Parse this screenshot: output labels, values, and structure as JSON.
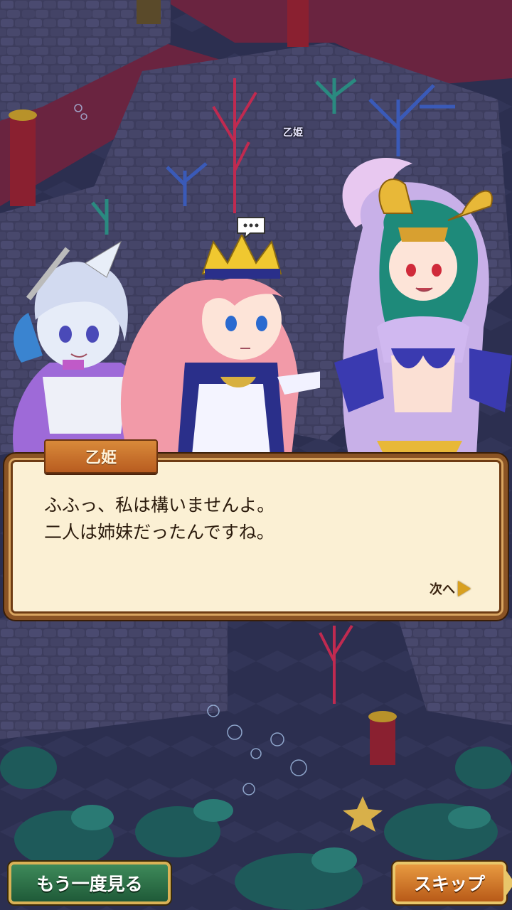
{
  "scene": {
    "map_label": "乙姫",
    "speech_bubble_icon": "speech-bubble-icon"
  },
  "dialogue": {
    "speaker": "乙姫",
    "lines": [
      "ふふっ、私は構いませんよ。",
      "二人は姉妹だったんですね。"
    ],
    "next_label": "次へ"
  },
  "buttons": {
    "replay": "もう一度見る",
    "skip": "スキップ"
  },
  "colors": {
    "carpet": "#6a2440",
    "floor": "#3a3a5c",
    "dialog_bg": "#fbf0d4",
    "dialog_border": "#8a5324",
    "replay_button": "#2f7049",
    "skip_button": "#d27a2c"
  }
}
